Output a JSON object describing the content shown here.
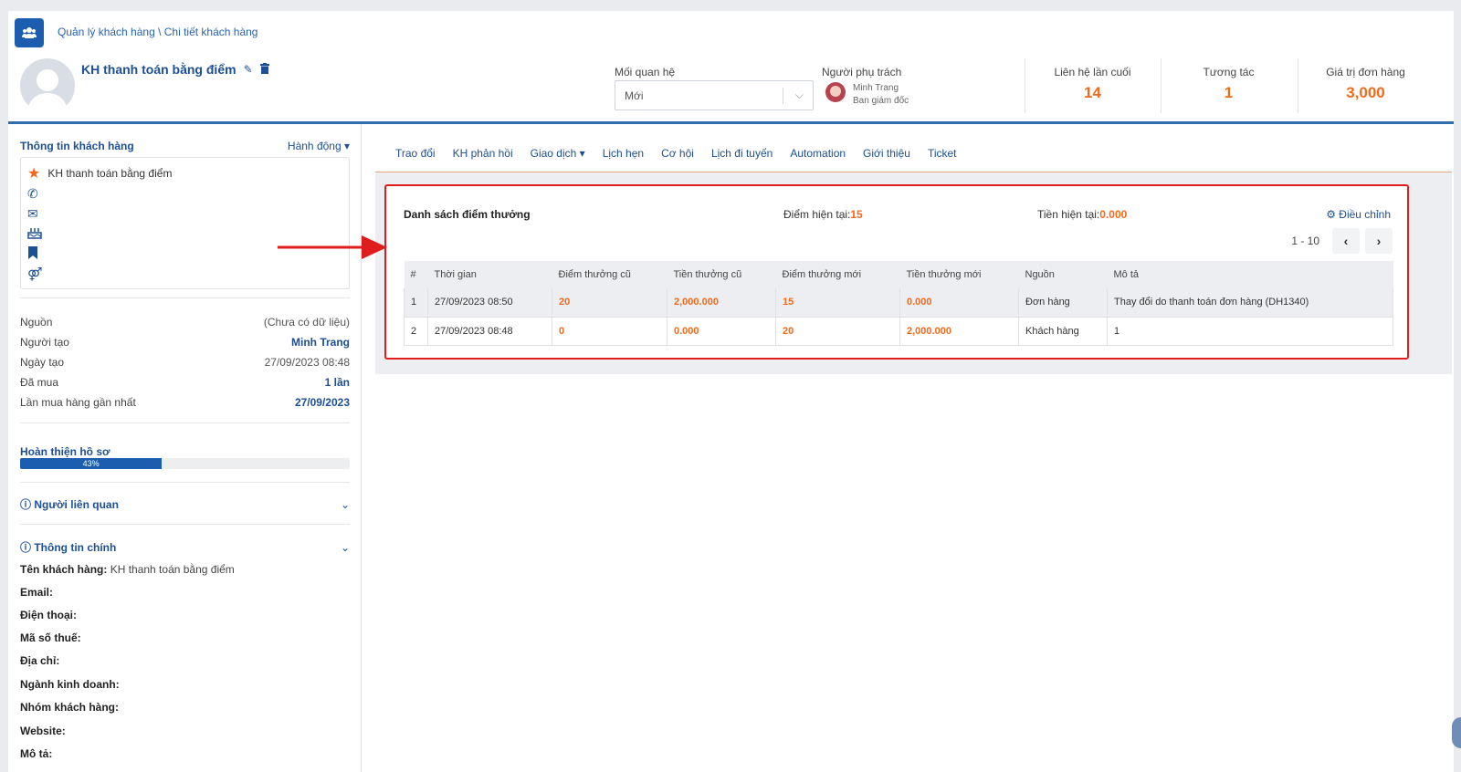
{
  "breadcrumb": "Quản lý khách hàng \\ Chi tiết khách hàng",
  "customer": {
    "name": "KH thanh toán bằng điểm"
  },
  "relationship": {
    "label": "Mối quan hệ",
    "value": "Mới"
  },
  "owner": {
    "label": "Người phụ trách",
    "name": "Minh Trang",
    "role": "Ban giám đốc"
  },
  "stats": [
    {
      "label": "Liên hệ lần cuối",
      "value": "14"
    },
    {
      "label": "Tương tác",
      "value": "1"
    },
    {
      "label": "Giá trị đơn hàng",
      "value": "3,000"
    }
  ],
  "left": {
    "section_title": "Thông tin khách hàng",
    "action_label": "Hành động ▾",
    "info_name": "KH thanh toán bằng điểm",
    "kv": [
      {
        "k": "Nguồn",
        "v": "(Chưa có dữ liệu)"
      },
      {
        "k": "Người tạo",
        "v": "Minh Trang"
      },
      {
        "k": "Ngày tạo",
        "v": "27/09/2023 08:48"
      },
      {
        "k": "Đã mua",
        "v": "1 lần"
      },
      {
        "k": "Lần mua hàng gần nhất",
        "v": "27/09/2023"
      }
    ],
    "profile_title": "Hoàn thiện hồ sơ",
    "profile_percent": "43%",
    "profile_fraction": 0.43,
    "related_title": "Người liên quan",
    "main_title": "Thông tin chính",
    "fields": [
      {
        "k": "Tên khách hàng:",
        "v": "KH thanh toán bằng điểm"
      },
      {
        "k": "Email:",
        "v": ""
      },
      {
        "k": "Điện thoại:",
        "v": ""
      },
      {
        "k": "Mã số thuế:",
        "v": ""
      },
      {
        "k": "Địa chỉ:",
        "v": ""
      },
      {
        "k": "Ngành kinh doanh:",
        "v": ""
      },
      {
        "k": "Nhóm khách hàng:",
        "v": ""
      },
      {
        "k": "Website:",
        "v": ""
      },
      {
        "k": "Mô tả:",
        "v": ""
      }
    ]
  },
  "tabs": [
    "Trao đổi",
    "KH phản hồi",
    "Giao dịch ▾",
    "Lịch hẹn",
    "Cơ hội",
    "Lịch đi tuyến",
    "Automation",
    "Giới thiệu",
    "Ticket"
  ],
  "points_card": {
    "title": "Danh sách điểm thưởng",
    "points_label": "Điểm hiện tại:",
    "points_value": "15",
    "money_label": "Tiền hiện tại:",
    "money_value": "0.000",
    "adjust_label": "Điều chỉnh",
    "pager_range": "1 - 10",
    "columns": [
      "#",
      "Thời gian",
      "Điểm thưởng cũ",
      "Tiền thưởng cũ",
      "Điểm thưởng mới",
      "Tiền thưởng mới",
      "Nguồn",
      "Mô tả"
    ],
    "rows": [
      [
        "1",
        "27/09/2023 08:50",
        "20",
        "2,000.000",
        "15",
        "0.000",
        "Đơn hàng",
        "Thay đổi do thanh toán đơn hàng (DH1340)"
      ],
      [
        "2",
        "27/09/2023 08:48",
        "0",
        "0.000",
        "20",
        "2,000.000",
        "Khách hàng",
        "1"
      ]
    ]
  },
  "colors": {
    "primary": "#1c5db0",
    "accent": "#f06a1d",
    "highlight": "#e01d1d"
  }
}
